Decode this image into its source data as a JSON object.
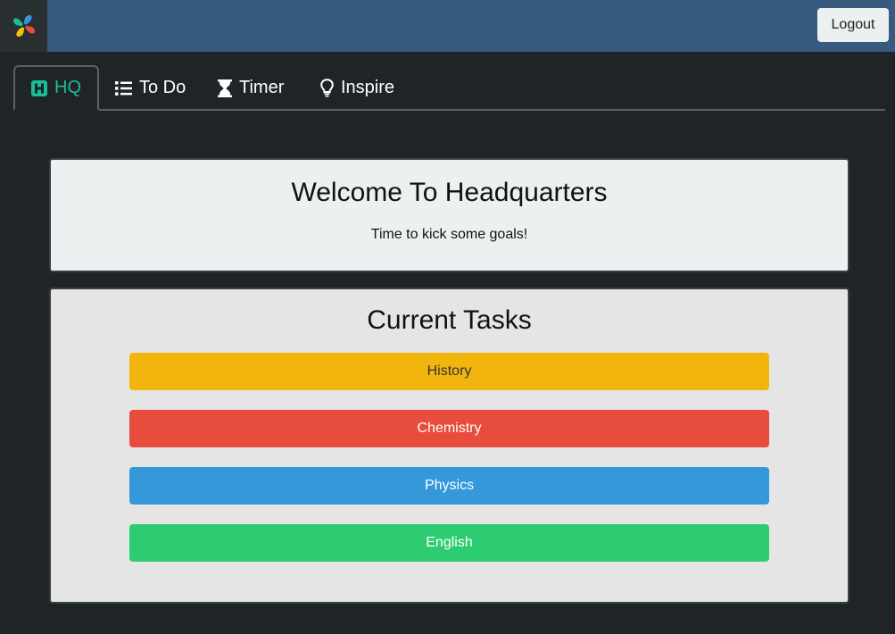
{
  "header": {
    "logo_icon": "flower-pinwheel-logo",
    "logout_label": "Logout"
  },
  "tabs": [
    {
      "label": "HQ",
      "icon": "h-square-icon",
      "active": true
    },
    {
      "label": "To Do",
      "icon": "list-icon",
      "active": false
    },
    {
      "label": "Timer",
      "icon": "hourglass-icon",
      "active": false
    },
    {
      "label": "Inspire",
      "icon": "lightbulb-icon",
      "active": false
    }
  ],
  "welcome": {
    "title": "Welcome To Headquarters",
    "subtitle": "Time to kick some goals!"
  },
  "tasks": {
    "title": "Current Tasks",
    "items": [
      {
        "label": "History",
        "color": "#f1b50e",
        "text_color": "#333333"
      },
      {
        "label": "Chemistry",
        "color": "#e74c3c",
        "text_color": "#ffffff"
      },
      {
        "label": "Physics",
        "color": "#3498db",
        "text_color": "#ffffff"
      },
      {
        "label": "English",
        "color": "#2ecc71",
        "text_color": "#ffffff"
      }
    ]
  },
  "colors": {
    "navbar": "#375a7f",
    "background": "#1f2426",
    "active_tab": "#1abc9c"
  }
}
